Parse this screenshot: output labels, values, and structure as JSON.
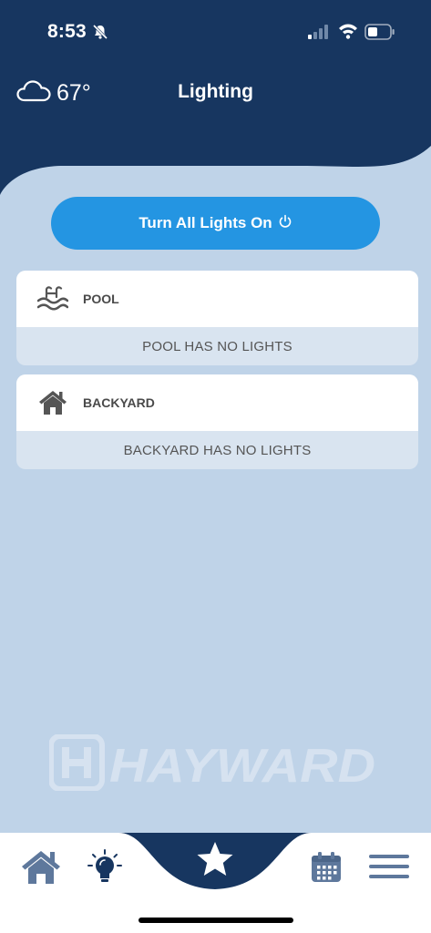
{
  "status_bar": {
    "time": "8:53"
  },
  "header": {
    "weather": {
      "temp": "67°",
      "icon": "cloud-icon"
    },
    "title": "Lighting"
  },
  "actions": {
    "turn_all_label": "Turn All Lights On"
  },
  "areas": [
    {
      "name": "POOL",
      "icon": "pool-icon",
      "empty_text": "POOL HAS NO LIGHTS"
    },
    {
      "name": "BACKYARD",
      "icon": "house-icon",
      "empty_text": "BACKYARD HAS NO LIGHTS"
    }
  ],
  "brand": {
    "logo_text": "HAYWARD"
  },
  "nav": [
    "home-icon",
    "lightbulb-icon",
    "star-icon",
    "calendar-icon",
    "menu-icon"
  ],
  "colors": {
    "header": "#173660",
    "background": "#bfd3e8",
    "accent": "#2495e2",
    "card": "#ffffff",
    "card_footer": "#d9e4f0",
    "nav_icon": "#5e789c"
  }
}
